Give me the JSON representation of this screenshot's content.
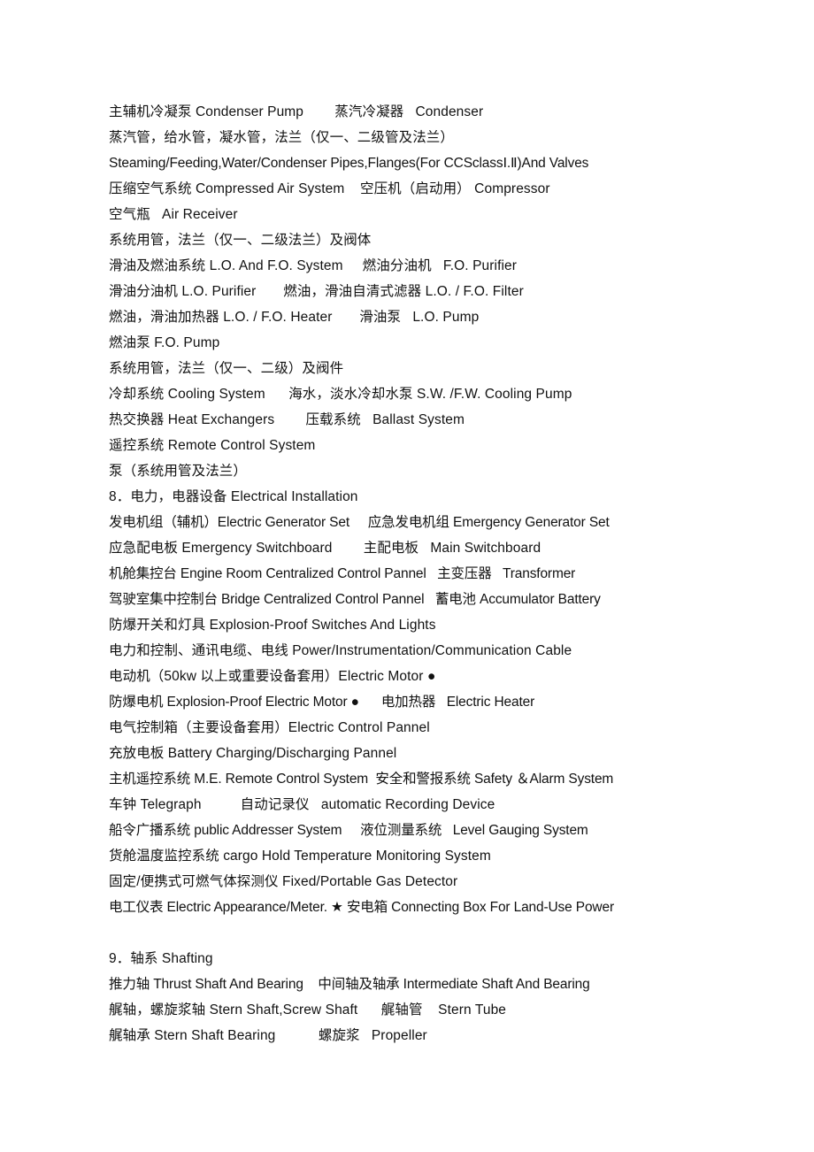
{
  "document": {
    "page_background": "#ffffff",
    "text_color": "#111111",
    "lines": [
      {
        "id": "line-condenser-pump",
        "text": "主辅机冷凝泵 Condenser Pump        蒸汽冷凝器   Condenser"
      },
      {
        "id": "line-steam-pipes-cn",
        "text": "蒸汽管，给水管，凝水管，法兰（仅一、二级管及法兰）"
      },
      {
        "id": "line-steaming-feeding-en",
        "text": "Steaming/Feeding,Water/Condenser Pipes,Flanges(For CCSclassⅠ.Ⅱ)And Valves"
      },
      {
        "id": "line-compressed-air",
        "text": "压缩空气系统 Compressed Air System    空压机（启动用） Compressor"
      },
      {
        "id": "line-air-receiver",
        "text": "空气瓶   Air Receiver"
      },
      {
        "id": "line-system-pipes-valvebody",
        "text": "系统用管，法兰（仅一、二级法兰）及阀体"
      },
      {
        "id": "line-lo-fo-system",
        "text": "滑油及燃油系统 L.O. And F.O. System     燃油分油机   F.O. Purifier"
      },
      {
        "id": "line-lo-purifier",
        "text": "滑油分油机 L.O. Purifier       燃油，滑油自清式滤器 L.O. / F.O. Filter"
      },
      {
        "id": "line-lo-fo-heater",
        "text": "燃油，滑油加热器 L.O. / F.O. Heater       滑油泵   L.O. Pump"
      },
      {
        "id": "line-fo-pump",
        "text": "燃油泵 F.O. Pump"
      },
      {
        "id": "line-system-pipes-valves",
        "text": "系统用管，法兰（仅一、二级）及阀件"
      },
      {
        "id": "line-cooling-system",
        "text": "冷却系统 Cooling System      海水，淡水冷却水泵 S.W. /F.W. Cooling Pump"
      },
      {
        "id": "line-heat-exchangers",
        "text": "热交换器 Heat Exchangers        压载系统   Ballast System"
      },
      {
        "id": "line-remote-control-system",
        "text": "遥控系统 Remote Control System"
      },
      {
        "id": "line-pumps-pipes-flanges",
        "text": "泵（系统用管及法兰）"
      },
      {
        "id": "line-section-8-heading",
        "text": "8．电力，电器设备 Electrical Installation"
      },
      {
        "id": "line-generator-sets",
        "text": "发电机组（辅机）Electric Generator Set     应急发电机组 Emergency Generator Set"
      },
      {
        "id": "line-switchboards",
        "text": "应急配电板 Emergency Switchboard        主配电板   Main Switchboard"
      },
      {
        "id": "line-engine-room-panel",
        "text": "机舱集控台 Engine Room Centralized Control Pannel   主变压器   Transformer"
      },
      {
        "id": "line-bridge-panel",
        "text": "驾驶室集中控制台 Bridge Centralized Control Pannel   蓄电池 Accumulator Battery"
      },
      {
        "id": "line-explosion-proof-switches",
        "text": "防爆开关和灯具 Explosion-Proof Switches And Lights"
      },
      {
        "id": "line-power-cable",
        "text": "电力和控制、通讯电缆、电线 Power/Instrumentation/Communication Cable"
      },
      {
        "id": "line-electric-motor",
        "text": "电动机（50kw 以上或重要设备套用）Electric Motor ●"
      },
      {
        "id": "line-explosion-proof-motor",
        "text": "防爆电机 Explosion-Proof Electric Motor ●      电加热器   Electric Heater"
      },
      {
        "id": "line-electric-control-pannel",
        "text": "电气控制箱（主要设备套用）Electric Control Pannel"
      },
      {
        "id": "line-battery-charging-pannel",
        "text": "充放电板 Battery Charging/Discharging Pannel"
      },
      {
        "id": "line-me-remote-control",
        "text": "主机遥控系统 M.E. Remote Control System  安全和警报系统 Safety ＆Alarm System"
      },
      {
        "id": "line-telegraph",
        "text": "车钟 Telegraph          自动记录仪   automatic Recording Device"
      },
      {
        "id": "line-public-addresser",
        "text": "船令广播系统 public Addresser System     液位测量系统   Level Gauging System"
      },
      {
        "id": "line-cargo-hold-temp",
        "text": "货舱温度监控系统 cargo Hold Temperature Monitoring System"
      },
      {
        "id": "line-gas-detector",
        "text": "固定/便携式可燃气体探测仪 Fixed/Portable Gas Detector"
      },
      {
        "id": "line-electric-appearance",
        "text": "电工仪表 Electric Appearance/Meter. ★ 安电箱 Connecting Box For Land-Use Power"
      },
      {
        "id": "line-blank-1",
        "text": " "
      },
      {
        "id": "line-section-9-heading",
        "text": "9．轴系 Shafting"
      },
      {
        "id": "line-thrust-shaft",
        "text": "推力轴 Thrust Shaft And Bearing    中间轴及轴承 Intermediate Shaft And Bearing"
      },
      {
        "id": "line-stern-shaft",
        "text": "艉轴，螺旋浆轴 Stern Shaft,Screw Shaft      艉轴管    Stern Tube"
      },
      {
        "id": "line-stern-shaft-bearing",
        "text": "艉轴承 Stern Shaft Bearing           螺旋浆   Propeller"
      }
    ]
  }
}
